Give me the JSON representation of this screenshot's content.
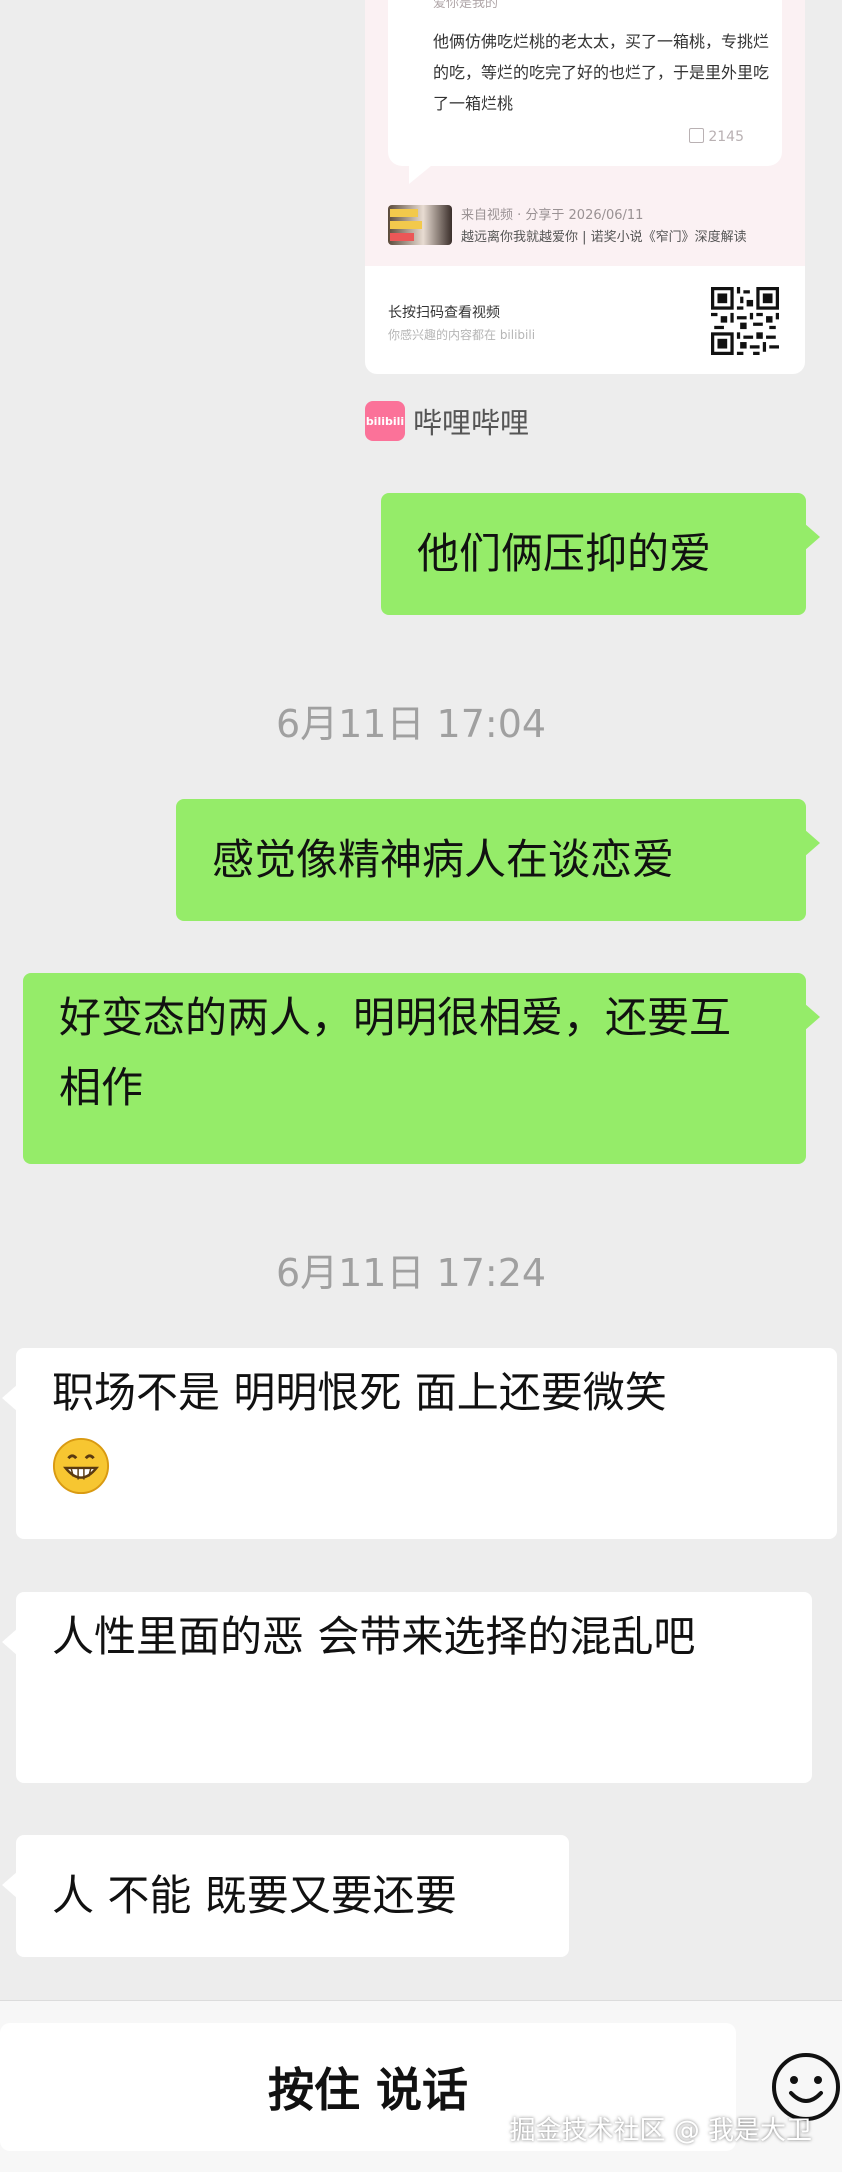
{
  "share_card": {
    "quote_head": "爱你是我的",
    "quote_text": "他俩仿佛吃烂桃的老太太，买了一箱桃，专挑烂的吃，等烂的吃完了好的也烂了，于是里外里吃了一箱烂桃",
    "like_count": "2145",
    "video_source": "来自视频 · 分享于 2026/06/11",
    "video_title": "越远离你我就越爱你 | 诺奖小说《窄门》深度解读",
    "scan_tip": "长按扫码查看视频",
    "scan_sub": "你感兴趣的内容都在 bilibili",
    "logo_text": "bilibili",
    "source_label": "哔哩哔哩"
  },
  "messages": [
    {
      "side": "right",
      "text": "他们俩压抑的爱"
    },
    {
      "type": "time",
      "text": "6月11日 17:04"
    },
    {
      "side": "right",
      "text": "感觉像精神病人在谈恋爱"
    },
    {
      "side": "right",
      "text": "好变态的两人，明明很相爱，还要互相作"
    },
    {
      "type": "time",
      "text": "6月11日 17:24"
    },
    {
      "side": "left",
      "text": "职场不是 明明恨死 面上还要微笑",
      "emoji": "grinning-face"
    },
    {
      "side": "left",
      "text": "人性里面的恶 会带来选择的混乱吧"
    },
    {
      "side": "left",
      "text": "人 不能 既要又要还要"
    }
  ],
  "input_bar": {
    "hold_to_talk": "按住 说话",
    "emoji_button_icon": "smiley-icon"
  },
  "watermark": "掘金技术社区 @ 我是大卫"
}
